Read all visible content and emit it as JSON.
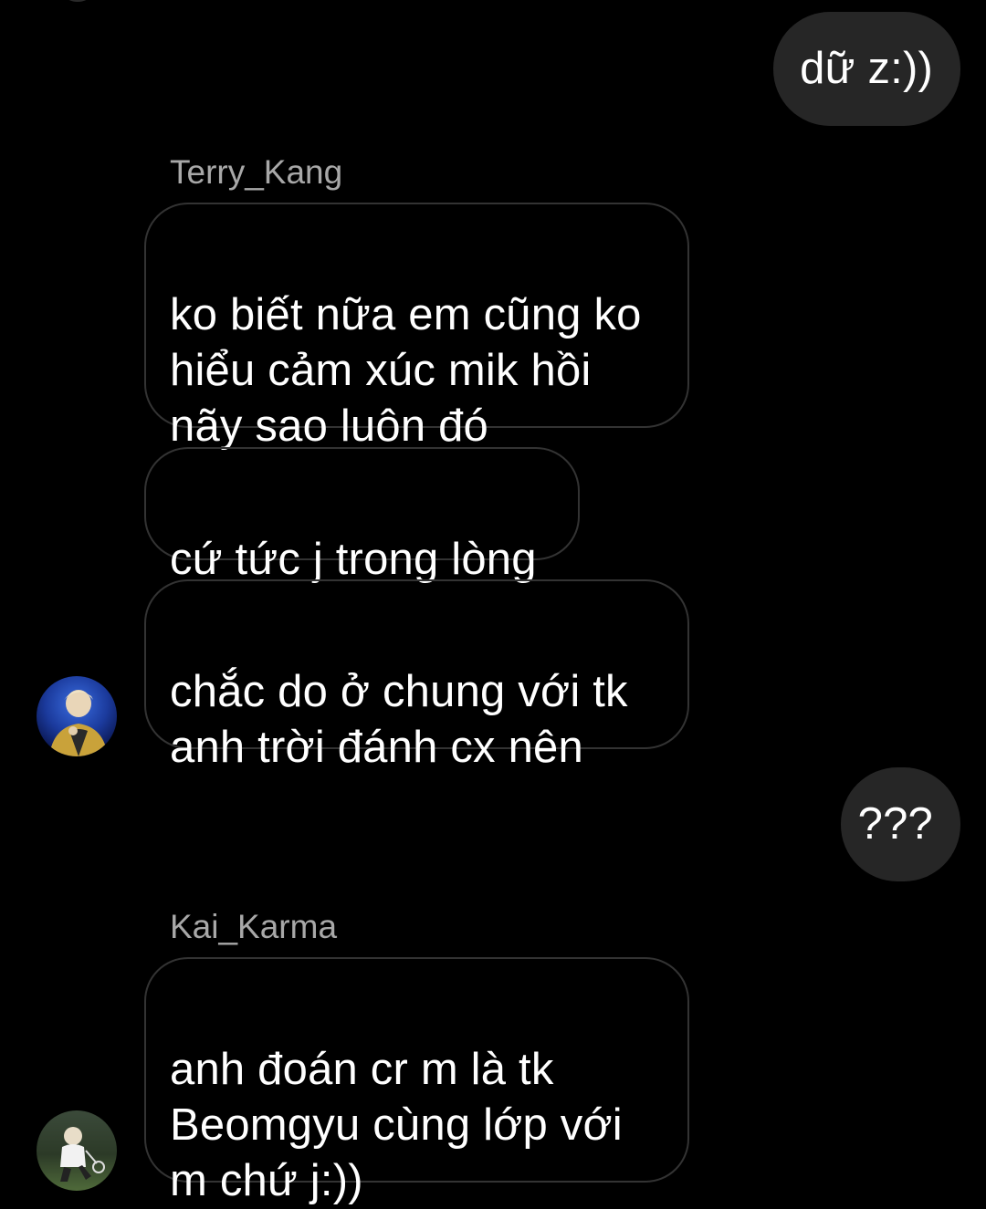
{
  "conversation": {
    "messages": [
      {
        "direction": "outgoing",
        "text": "dữ z:))"
      },
      {
        "direction": "incoming",
        "sender": "Terry_Kang",
        "text": "ko biết nữa em cũng ko\nhiểu cảm xúc mik hồi\nnãy sao luôn đó"
      },
      {
        "direction": "incoming",
        "text": "cứ tức j trong lòng"
      },
      {
        "direction": "incoming",
        "text": "chắc do ở chung với tk\nanh trời đánh cx nên"
      },
      {
        "direction": "outgoing",
        "text": "???"
      },
      {
        "direction": "incoming",
        "sender": "Kai_Karma",
        "text": "anh đoán cr m là tk\nBeomgyu cùng lớp với\nm chứ j:))"
      }
    ]
  },
  "theme": {
    "background": "#000000",
    "outgoing_bubble": "#262626",
    "incoming_border": "#333333",
    "sender_name_color": "#a8a8a8",
    "text_color": "#ffffff"
  }
}
